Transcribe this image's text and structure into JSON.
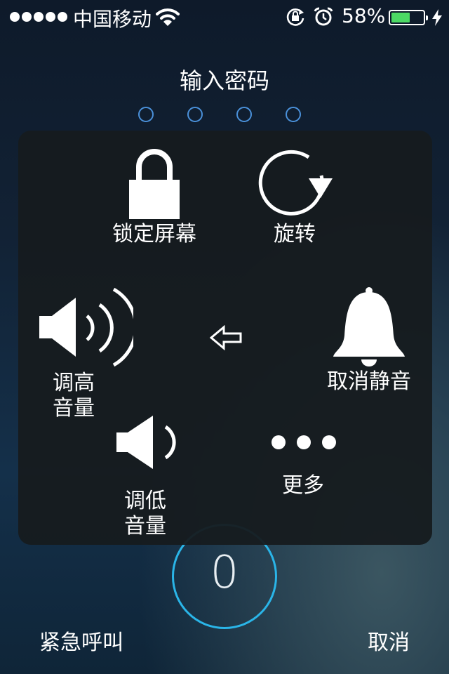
{
  "status_bar": {
    "carrier": "中国移动",
    "battery_percent_text": "58%",
    "battery_level": 0.58,
    "battery_color": "#4cd964",
    "icons": [
      "signal-dots",
      "wifi-icon",
      "rotation-lock-icon",
      "alarm-icon",
      "battery-icon",
      "charging-bolt-icon"
    ]
  },
  "passcode": {
    "title": "输入密码",
    "digits_entered": 0,
    "digit_count": 4,
    "dot_color": "#4a90d9"
  },
  "keypad": {
    "zero_label": "0",
    "ring_color": "#2ab5e8"
  },
  "bottom": {
    "emergency_label": "紧急呼叫",
    "cancel_label": "取消"
  },
  "assistive_menu": {
    "lock_screen": "锁定屏幕",
    "rotate": "旋转",
    "volume_up_line1": "调高",
    "volume_up_line2": "音量",
    "unmute": "取消静音",
    "volume_down_line1": "调低",
    "volume_down_line2": "音量",
    "more": "更多",
    "back_icon": "back-arrow-icon"
  }
}
